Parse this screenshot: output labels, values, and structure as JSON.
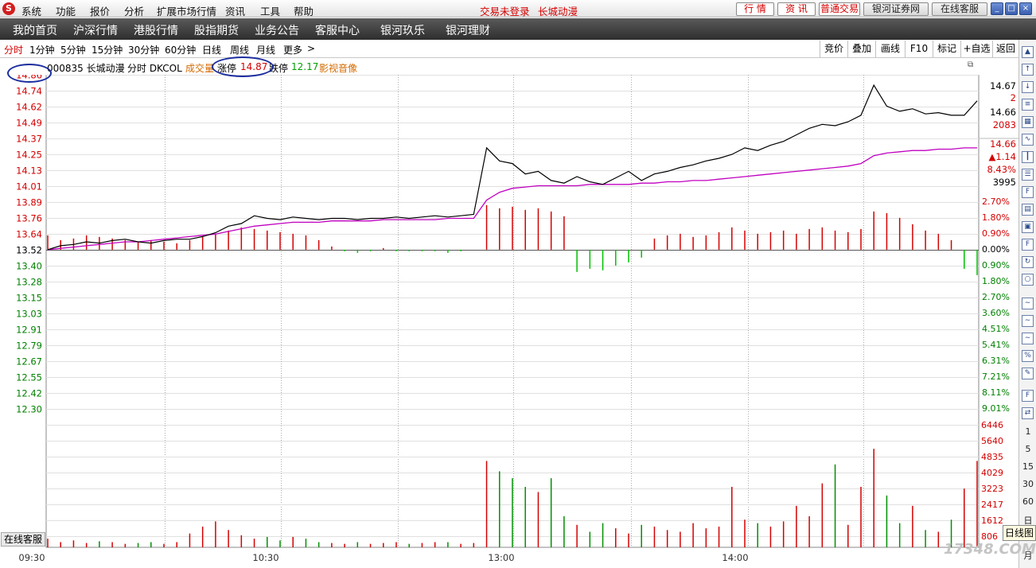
{
  "menubar": {
    "items": [
      "系统",
      "功能",
      "报价",
      "分析",
      "扩展市场行情",
      "资讯",
      "工具",
      "帮助"
    ],
    "status_login": "交易未登录",
    "status_stock": "长城动漫",
    "buttons": [
      "行 情",
      "资 讯",
      "普通交易",
      "银河证券网",
      "在线客服"
    ]
  },
  "navbar": {
    "items": [
      "我的首页",
      "沪深行情",
      "港股行情",
      "股指期货",
      "业务公告",
      "客服中心",
      "银河玖乐",
      "银河理财"
    ]
  },
  "toolbar": {
    "timeframes": [
      "分时",
      "1分钟",
      "5分钟",
      "15分钟",
      "30分钟",
      "60分钟",
      "日线",
      "周线",
      "月线",
      "更多",
      "&gt;"
    ],
    "right_buttons": [
      "竞价",
      "叠加",
      "画线",
      "F10",
      "标记",
      "+自选",
      "返回"
    ]
  },
  "info": {
    "code_name": "000835 长城动漫",
    "mode": "分时 DKCOL",
    "volume_label": "成交量",
    "limit_up_label": "涨停",
    "limit_up_value": "14.87",
    "limit_down_label": "跌停",
    "limit_down_value": "12.17",
    "media": "影视音像"
  },
  "left_axis_prices": [
    "14.86",
    "14.74",
    "14.62",
    "14.49",
    "14.37",
    "14.25",
    "14.13",
    "14.01",
    "13.89",
    "13.76",
    "13.64",
    "13.52",
    "13.40",
    "13.28",
    "13.15",
    "13.03",
    "12.91",
    "12.79",
    "12.67",
    "12.55",
    "12.42",
    "12.30"
  ],
  "right_axis_pct": [
    "2.70%",
    "1.80%",
    "0.90%",
    "0.00%",
    "0.90%",
    "1.80%",
    "2.70%",
    "3.60%",
    "4.51%",
    "5.41%",
    "6.31%",
    "7.21%",
    "8.11%",
    "9.01%"
  ],
  "right_panel": {
    "price": "14.67",
    "qty": "2",
    "price2": "14.66",
    "vol": "2083",
    "last": "14.66",
    "change": "▲1.14",
    "pct": "8.43%",
    "total": "3995"
  },
  "volume_axis": [
    "6446",
    "5640",
    "4835",
    "4029",
    "3223",
    "2417",
    "1612",
    "806"
  ],
  "time_labels": [
    "09:30",
    "10:30",
    "13:00",
    "14:00"
  ],
  "sidebar": {
    "numbers": [
      "1",
      "5",
      "15",
      "30",
      "60",
      "日",
      "月"
    ]
  },
  "bottom": {
    "kefu": "在线客服",
    "rixiantu": "日线图",
    "watermark": "17348.COM"
  },
  "colors": {
    "up": "#d40000",
    "down": "#00a000",
    "price_line": "#000000",
    "avg_line": "#c000c0",
    "annot": "#1a2d9e"
  },
  "chart_data": {
    "type": "line",
    "prev_close": 13.52,
    "ylim": [
      12.3,
      14.86
    ],
    "price_line": [
      13.52,
      13.55,
      13.56,
      13.58,
      13.57,
      13.59,
      13.6,
      13.58,
      13.57,
      13.59,
      13.6,
      13.6,
      13.62,
      13.65,
      13.7,
      13.72,
      13.78,
      13.76,
      13.75,
      13.77,
      13.76,
      13.75,
      13.76,
      13.76,
      13.75,
      13.76,
      13.76,
      13.77,
      13.76,
      13.77,
      13.78,
      13.77,
      13.78,
      13.79,
      14.3,
      14.2,
      14.18,
      14.1,
      14.12,
      14.05,
      14.03,
      14.08,
      14.04,
      14.02,
      14.07,
      14.12,
      14.05,
      14.1,
      14.12,
      14.15,
      14.17,
      14.2,
      14.22,
      14.25,
      14.3,
      14.28,
      14.32,
      14.35,
      14.4,
      14.45,
      14.48,
      14.47,
      14.5,
      14.55,
      14.78,
      14.62,
      14.58,
      14.6,
      14.56,
      14.57,
      14.55,
      14.55,
      14.66
    ],
    "avg_line": [
      13.52,
      13.53,
      13.54,
      13.55,
      13.56,
      13.57,
      13.58,
      13.58,
      13.59,
      13.6,
      13.61,
      13.62,
      13.63,
      13.64,
      13.66,
      13.68,
      13.7,
      13.71,
      13.72,
      13.73,
      13.73,
      13.73,
      13.74,
      13.74,
      13.74,
      13.74,
      13.75,
      13.75,
      13.75,
      13.75,
      13.75,
      13.76,
      13.76,
      13.76,
      13.9,
      13.96,
      13.99,
      14.0,
      14.01,
      14.01,
      14.01,
      14.01,
      14.02,
      14.02,
      14.02,
      14.02,
      14.03,
      14.03,
      14.04,
      14.04,
      14.05,
      14.05,
      14.06,
      14.07,
      14.08,
      14.09,
      14.1,
      14.11,
      14.12,
      14.13,
      14.14,
      14.15,
      14.16,
      14.18,
      14.24,
      14.26,
      14.27,
      14.28,
      14.28,
      14.29,
      14.29,
      14.3,
      14.3
    ],
    "diff_bars": [
      0.9,
      0.6,
      0.7,
      0.9,
      0.8,
      0.7,
      0.6,
      0.5,
      0.6,
      0.5,
      0.4,
      0.6,
      0.8,
      1.0,
      1.2,
      1.4,
      1.3,
      1.2,
      1.1,
      1.0,
      0.9,
      0.6,
      0.2,
      -0.1,
      -0.2,
      -0.1,
      0.1,
      -0.1,
      -0.1,
      -0.1,
      -0.1,
      -0.2,
      -0.1,
      0.0,
      2.8,
      2.6,
      2.7,
      2.5,
      2.6,
      2.4,
      2.1,
      -1.4,
      -1.2,
      -1.3,
      -1.0,
      -0.8,
      -0.5,
      0.7,
      0.9,
      1.0,
      0.8,
      0.9,
      1.1,
      1.4,
      1.2,
      1.0,
      1.1,
      1.2,
      1.0,
      1.3,
      1.4,
      1.2,
      1.1,
      1.3,
      2.4,
      2.3,
      2.0,
      1.6,
      1.2,
      1.0,
      0.6,
      -1.2,
      -1.6
    ],
    "volume": [
      500,
      300,
      400,
      250,
      350,
      300,
      200,
      250,
      300,
      200,
      300,
      800,
      1200,
      1500,
      1000,
      700,
      500,
      600,
      400,
      600,
      500,
      300,
      250,
      200,
      300,
      200,
      250,
      300,
      200,
      250,
      300,
      300,
      200,
      250,
      5000,
      4400,
      4000,
      3500,
      3200,
      4000,
      1800,
      1300,
      900,
      1400,
      1100,
      800,
      1300,
      1200,
      1000,
      900,
      1400,
      1100,
      1200,
      3500,
      1600,
      1400,
      1200,
      1500,
      2400,
      1800,
      3700,
      4800,
      1300,
      3500,
      5700,
      3000,
      1400,
      2400,
      1000,
      900,
      1600,
      3400,
      5000
    ],
    "time_labels": [
      "09:30",
      "10:30",
      "13:00",
      "14:00"
    ]
  }
}
